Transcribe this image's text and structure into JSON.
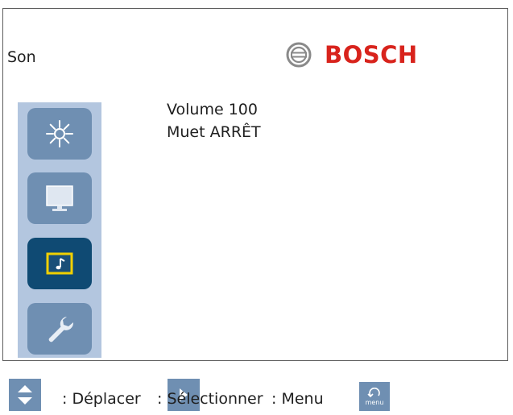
{
  "header": {
    "title": "Son",
    "brand": "BOSCH",
    "brand_color": "#d8231c"
  },
  "sidebar": {
    "items": [
      {
        "icon": "brightness-icon",
        "active": false
      },
      {
        "icon": "monitor-icon",
        "active": false
      },
      {
        "icon": "sound-icon",
        "active": true
      },
      {
        "icon": "wrench-icon",
        "active": false
      }
    ]
  },
  "menu": {
    "volume": "Volume 100",
    "mute": "Muet ARRÊT"
  },
  "footer": {
    "move_label": ": Déplacer",
    "select_label": ": Sélectionner",
    "menu_label": ": Menu",
    "menu_key_text": "menu"
  },
  "colors": {
    "button": "#6f8fb2",
    "button_active": "#0f4a73",
    "sidebar_bg": "#b3c6df",
    "highlight": "#f0d000"
  }
}
